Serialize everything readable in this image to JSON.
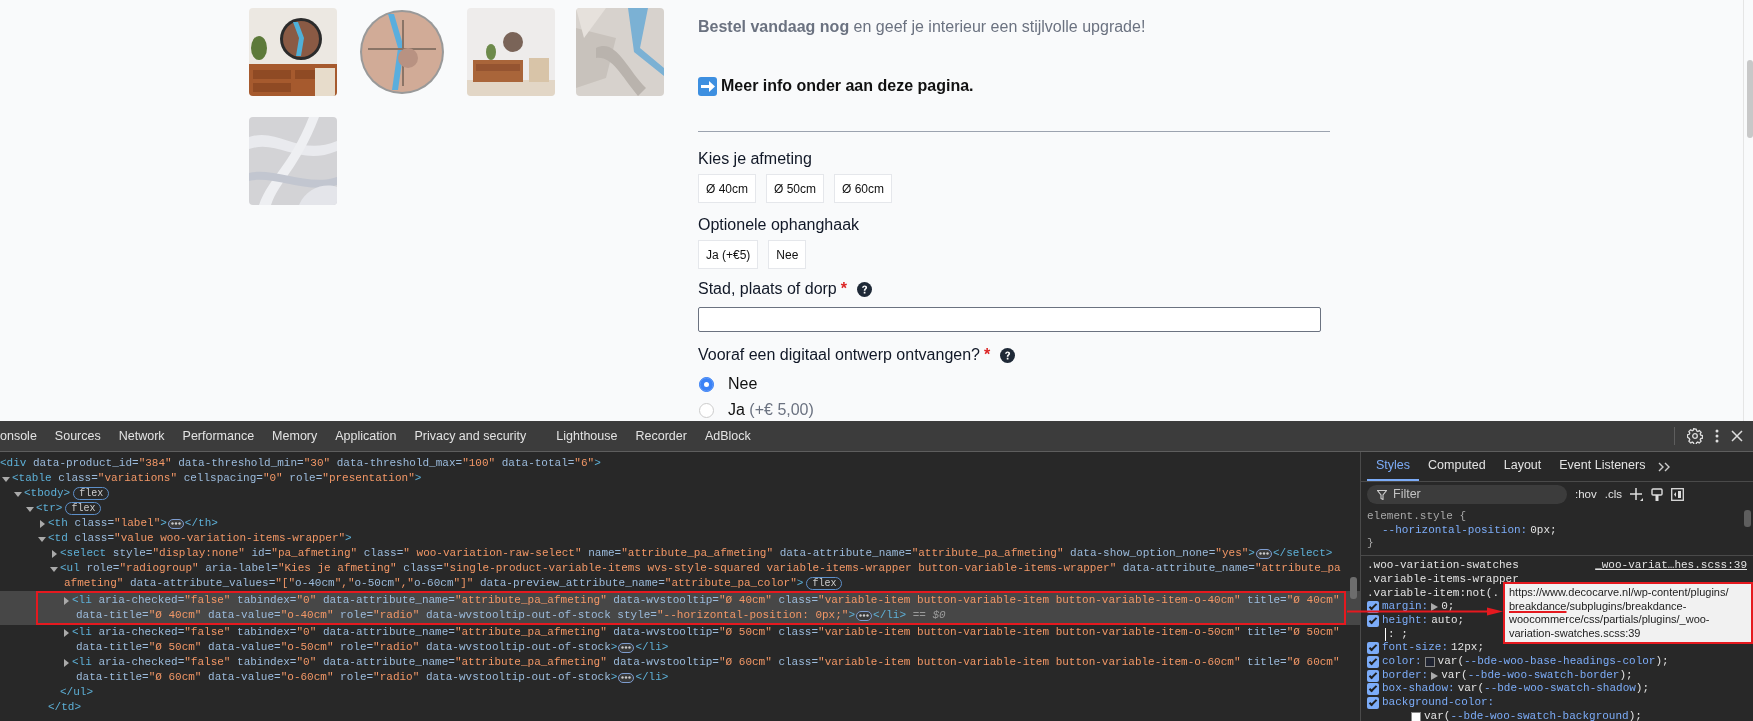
{
  "page": {
    "intro": "**Bestel vandaag nog** en geef je interieur een stijlvolle upgrade!",
    "more_info": "Meer info onder aan deze pagina.",
    "swatch_groups": [
      {
        "label": "Kies je afmeting",
        "options": [
          {
            "label": "Ø 40cm",
            "selected": false
          },
          {
            "label": "Ø 50cm",
            "selected": false
          },
          {
            "label": "Ø 60cm",
            "selected": false
          }
        ]
      },
      {
        "label": "Optionele ophanghaak",
        "options": [
          {
            "label": "Ja (+€5)",
            "selected": false
          },
          {
            "label": "Nee",
            "selected": false
          }
        ]
      }
    ],
    "text_field": {
      "label": "Stad, plaats of dorp",
      "required_mark": "*"
    },
    "radio_group": {
      "label": "Vooraf een digitaal ontwerp ontvangen?",
      "required_mark": "*",
      "options": [
        {
          "label": "Nee",
          "selected": true
        },
        {
          "label": "Ja",
          "price": "(+€ 5,00)",
          "selected": false
        }
      ]
    }
  },
  "devtools": {
    "tabs": [
      {
        "label": "onsole",
        "selected": false
      },
      {
        "label": "Sources",
        "selected": false
      },
      {
        "label": "Network",
        "selected": false
      },
      {
        "label": "Performance",
        "selected": false
      },
      {
        "label": "Memory",
        "selected": false
      },
      {
        "label": "Application",
        "selected": false
      },
      {
        "label": "Privacy and security",
        "selected": false
      },
      {
        "label": "Lighthouse",
        "selected": false
      },
      {
        "label": "Recorder",
        "selected": false
      },
      {
        "label": "AdBlock",
        "selected": false
      }
    ],
    "elements": [
      {
        "lines": [
          "<div data-product_id=\"384\" data-threshold_min=\"30\" data-threshold_max=\"100\" data-total=\"6\">"
        ],
        "selected": false,
        "children": [
          {
            "expanded": true,
            "lines": [
              "<table class=\"variations\" cellspacing=\"0\" role=\"presentation\">"
            ],
            "selected": false,
            "children": [
              {
                "expanded": true,
                "lines": [
                  "<tbody>"
                ],
                "badge": "flex",
                "selected": false,
                "children": [
                  {
                    "expanded": true,
                    "lines": [
                      "<tr>"
                    ],
                    "badge": "flex",
                    "selected": false,
                    "children": [
                      {
                        "expanded": false,
                        "lines": [
                          "<th class=\"label\">"
                        ],
                        "ellipsis": true,
                        "tail": "</th>",
                        "selected": false
                      },
                      {
                        "expanded": true,
                        "lines": [
                          "<td class=\"value woo-variation-items-wrapper\">"
                        ],
                        "closing": "</td>",
                        "selected": false,
                        "children": [
                          {
                            "expanded": false,
                            "lines": [
                              "<select style=\"display:none\" id=\"pa_afmeting\" class=\" woo-variation-raw-select\" name=\"attribute_pa_afmeting\" data-attribute_name=\"attribute_pa_afmeting\" data-show_option_none=\"yes\">"
                            ],
                            "ellipsis": true,
                            "tail": "</select>",
                            "selected": false
                          },
                          {
                            "expanded": true,
                            "lines": [
                              "<ul role=\"radiogroup\" aria-label=\"Kies je afmeting\" class=\"single-product-variable-items wvs-style-squared variable-items-wrapper button-variable-items-wrapper\" data-attribute_name=\"attribute_pa",
                              "afmeting\" data-attribute_values=\"[\"o-40cm\",\"o-50cm\",\"o-60cm\"]\" data-preview_attribute_name=\"attribute_pa_color\">"
                            ],
                            "badge": "flex",
                            "closing": "</ul>",
                            "selected": false,
                            "children": [
                              {
                                "expanded": false,
                                "lines": [
                                  "<li aria-checked=\"false\" tabindex=\"0\" data-attribute_name=\"attribute_pa_afmeting\" data-wvstooltip=\"Ø 40cm\" class=\"variable-item button-variable-item button-variable-item-o-40cm\" title=\"Ø 40cm\"",
                                  "data-title=\"Ø 40cm\" data-value=\"o-40cm\" role=\"radio\" data-wvstooltip-out-of-stock style=\"--horizontal-position: 0px;\">"
                                ],
                                "ellipsis": true,
                                "tail": "</li>",
                                "marker": "== $0",
                                "selected": true,
                                "framed": true
                              },
                              {
                                "expanded": false,
                                "lines": [
                                  "<li aria-checked=\"false\" tabindex=\"0\" data-attribute_name=\"attribute_pa_afmeting\" data-wvstooltip=\"Ø 50cm\" class=\"variable-item button-variable-item button-variable-item-o-50cm\" title=\"Ø 50cm\"",
                                  "data-title=\"Ø 50cm\" data-value=\"o-50cm\" role=\"radio\" data-wvstooltip-out-of-stock>"
                                ],
                                "ellipsis": true,
                                "tail": "</li>",
                                "selected": false
                              },
                              {
                                "expanded": false,
                                "lines": [
                                  "<li aria-checked=\"false\" tabindex=\"0\" data-attribute_name=\"attribute_pa_afmeting\" data-wvstooltip=\"Ø 60cm\" class=\"variable-item button-variable-item button-variable-item-o-60cm\" title=\"Ø 60cm\"",
                                  "data-title=\"Ø 60cm\" data-value=\"o-60cm\" role=\"radio\" data-wvstooltip-out-of-stock>"
                                ],
                                "ellipsis": true,
                                "tail": "</li>",
                                "selected": false
                              }
                            ]
                          }
                        ]
                      }
                    ]
                  }
                ]
              }
            ]
          }
        ]
      }
    ],
    "styles": {
      "tabs": [
        {
          "label": "Styles",
          "selected": true
        },
        {
          "label": "Computed",
          "selected": false
        },
        {
          "label": "Layout",
          "selected": false
        },
        {
          "label": "Event Listeners",
          "selected": false
        }
      ],
      "filter": {
        "placeholder": "Filter"
      },
      "toggles": [
        ":hov",
        ".cls"
      ],
      "rules": [
        {
          "kind": "inline",
          "selector_lines": [
            "element.style {"
          ],
          "declarations": [
            {
              "kind": "property",
              "name": "--horizontal-position:",
              "value": "0px;"
            }
          ],
          "closing": "}"
        },
        {
          "kind": "matched",
          "selector_lines": [
            ".woo-variation-swatches",
            ".variable-items-wrapper",
            ".variable-item:not(."
          ],
          "source": "_woo-variat…hes.scss:39",
          "declarations": [
            {
              "kind": "property",
              "name": "margin:",
              "value": "0;",
              "expandable": true,
              "checked": true
            },
            {
              "kind": "property",
              "name": "height:",
              "value": "auto;",
              "checked": true
            },
            {
              "kind": "editing",
              "text": ": ;"
            },
            {
              "kind": "property",
              "name": "font-size:",
              "value": "12px;",
              "checked": true
            },
            {
              "kind": "property",
              "name": "color:",
              "color": "#1f2330",
              "value": "var(--bde-woo-base-headings-color);",
              "checked": true
            },
            {
              "kind": "property",
              "name": "border:",
              "value": "var(--bde-woo-swatch-border);",
              "expandable": true,
              "checked": true
            },
            {
              "kind": "property",
              "name": "box-shadow:",
              "value": "var(--bde-woo-swatch-shadow);",
              "checked": true
            },
            {
              "kind": "property",
              "name": "background-color:",
              "color": "#ffffff",
              "value": "var(--bde-woo-swatch-background);",
              "wrapped": true,
              "checked": true
            }
          ]
        }
      ]
    },
    "tooltip": {
      "framed": true,
      "callout_arrow": true,
      "lines": [
        {
          "parts": [
            {
              "text": "https://www.decocarve.nl/wp-content/plugins/",
              "underlined": false
            }
          ]
        },
        {
          "parts": [
            {
              "text": "breakdance",
              "underlined": true
            },
            {
              "text": "/subplugins/breakdance-",
              "underlined": false
            }
          ]
        },
        {
          "parts": [
            {
              "text": "woocommerce/css/partials/plugins/_woo-",
              "underlined": false
            }
          ]
        },
        {
          "parts": [
            {
              "text": "variation-swatches.scss:39",
              "underlined": false
            }
          ]
        }
      ]
    }
  }
}
